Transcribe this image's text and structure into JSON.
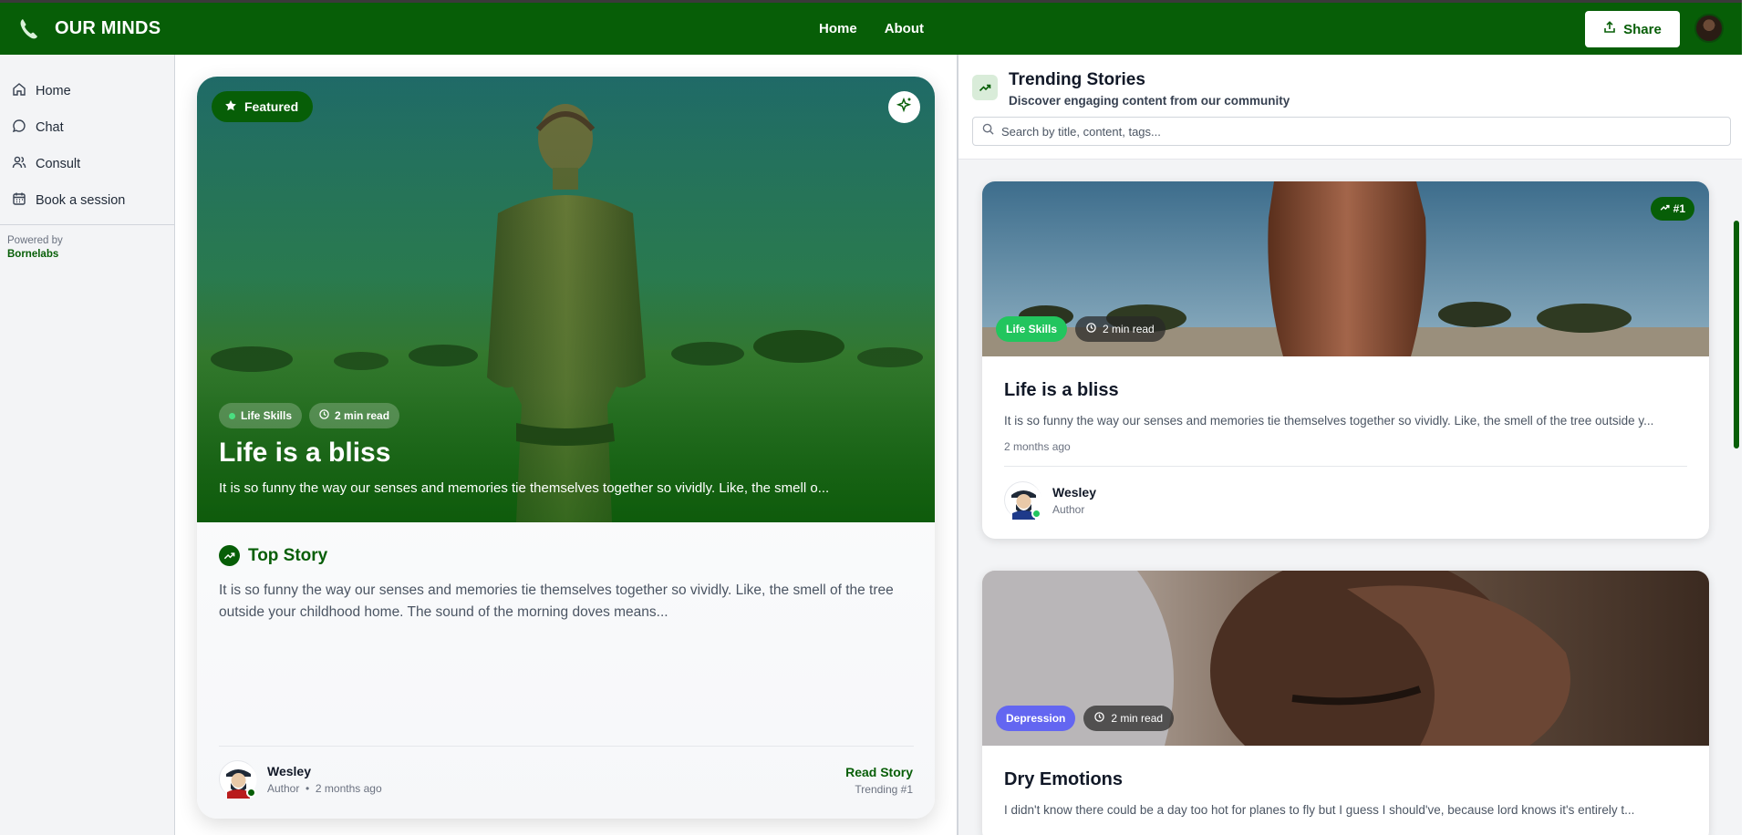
{
  "app": {
    "brand": "OUR MINDS",
    "nav": [
      "Home",
      "About"
    ],
    "share_label": "Share"
  },
  "sidebar": {
    "items": [
      {
        "label": "Home",
        "icon": "home-icon"
      },
      {
        "label": "Chat",
        "icon": "chat-icon"
      },
      {
        "label": "Consult",
        "icon": "users-icon"
      },
      {
        "label": "Book a session",
        "icon": "calendar-icon"
      }
    ],
    "powered_by": "Powered by",
    "company": "Bornelabs"
  },
  "featured": {
    "badge": "Featured",
    "category": "Life Skills",
    "read_time": "2 min read",
    "title": "Life is a bliss",
    "excerpt": "It is so funny the way our senses and memories tie themselves together so vividly. Like, the smell o...",
    "section_label": "Top Story",
    "body": "It is so funny the way our senses and memories tie themselves together so vividly. Like, the smell of the tree outside your childhood home. The sound of the morning doves means...",
    "author": "Wesley",
    "author_role": "Author",
    "posted": "2 months ago",
    "read_label": "Read Story",
    "trending_label": "Trending #1"
  },
  "trending": {
    "title": "Trending Stories",
    "subtitle": "Discover engaging content from our community",
    "search_placeholder": "Search by title, content, tags...",
    "stories": [
      {
        "rank": "#1",
        "category": "Life Skills",
        "category_color": "#22c55e",
        "read_time": "2 min read",
        "title": "Life is a bliss",
        "excerpt": "It is so funny the way our senses and memories tie themselves together so vividly. Like, the smell of the tree outside y...",
        "date": "2 months ago",
        "author": "Wesley",
        "author_role": "Author"
      },
      {
        "category": "Depression",
        "category_color": "#6366f1",
        "read_time": "2 min read",
        "title": "Dry Emotions",
        "excerpt": "I didn't know there could be a day too hot for planes to fly but I guess I should've, because lord knows it's entirely t..."
      }
    ]
  },
  "colors": {
    "brand_green": "#075e07",
    "life_skills": "#22c55e",
    "depression": "#6366f1"
  }
}
